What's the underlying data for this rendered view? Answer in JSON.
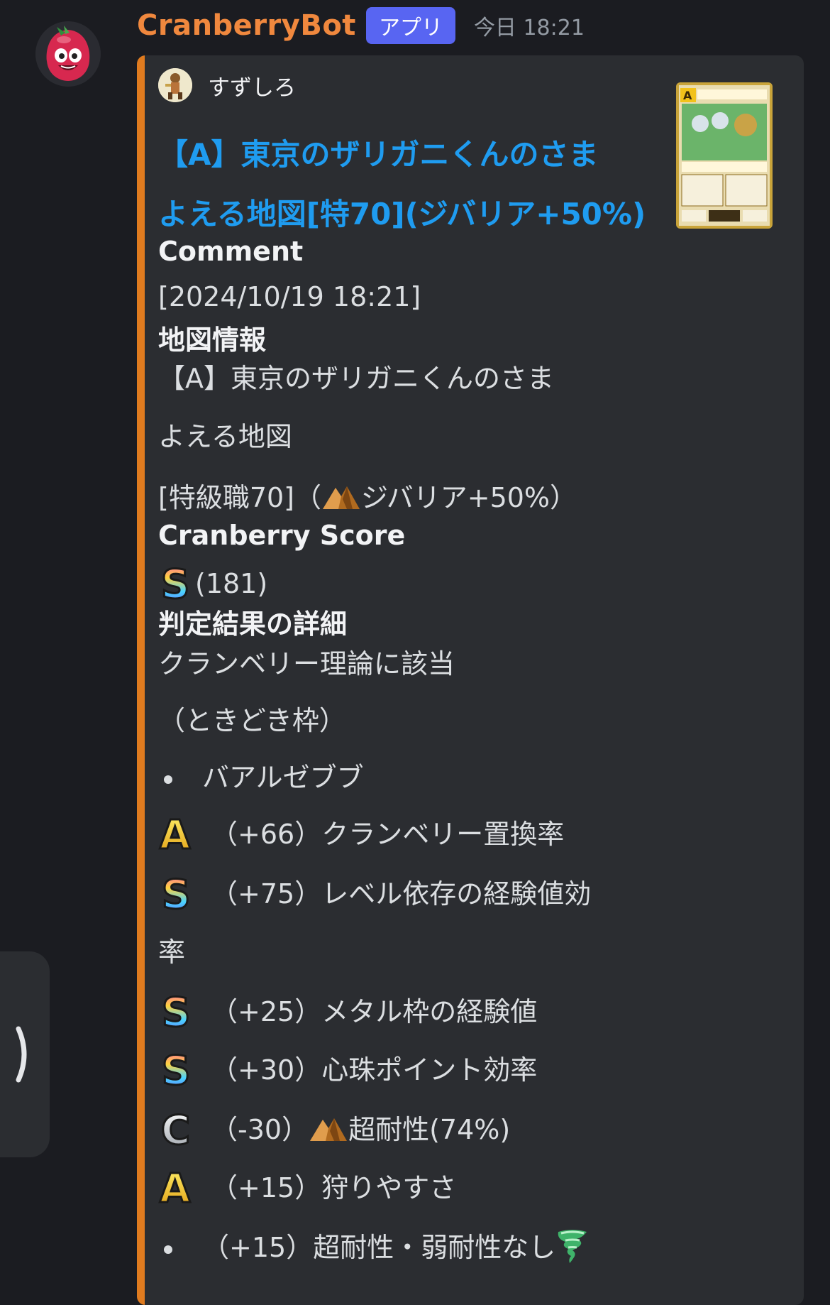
{
  "message": {
    "bot_name": "CranberryBot",
    "app_badge": "アプリ",
    "timestamp": "今日 18:21",
    "avatar_icon": "cranberry-slime-avatar"
  },
  "embed": {
    "accent_color": "#e07b1f",
    "author_name": "すずしろ",
    "title_line1": "【A】東京のザリガニくんのさま",
    "title_line2": "よえる地図[特70](ジバリア+50%)",
    "title_color": "#1f9cf0",
    "thumbnail_icon": "treasure-map-screenshot"
  },
  "fields": {
    "comment_label": "Comment",
    "comment_value": "[2024/10/19 18:21]",
    "map_info_label": "地図情報",
    "map_info_line1": "【A】東京のザリガニくんのさま",
    "map_info_line2": "よえる地図",
    "map_info_line3_prefix": "[特級職70]（",
    "map_info_line3_suffix": "ジバリア+50%）",
    "score_label": "Cranberry Score",
    "score_value": "(181)",
    "score_grade": "S",
    "detail_label": "判定結果の詳細",
    "detail_line1": "クランベリー理論に該当",
    "detail_line2": "（ときどき枠）",
    "monster": "バアルゼブブ",
    "items": [
      {
        "grade": "A",
        "text": "（+66）クランベリー置換率"
      },
      {
        "grade": "S",
        "text": "（+75）レベル依存の経験値効",
        "wrap": "率"
      },
      {
        "grade": "S",
        "text": "（+25）メタル枠の経験値"
      },
      {
        "grade": "S",
        "text": "（+30）心珠ポイント効率"
      },
      {
        "grade": "C",
        "text_prefix": "（-30）",
        "text_suffix": "超耐性(74%)"
      },
      {
        "grade": "A",
        "text": "（+15）狩りやすさ"
      }
    ],
    "last_item": "（+15）超耐性・弱耐性なし"
  },
  "colors": {
    "background": "#1b1c21",
    "embed_bg": "#2b2d31",
    "bot_name": "#f0883e",
    "badge": "#5865f2"
  }
}
